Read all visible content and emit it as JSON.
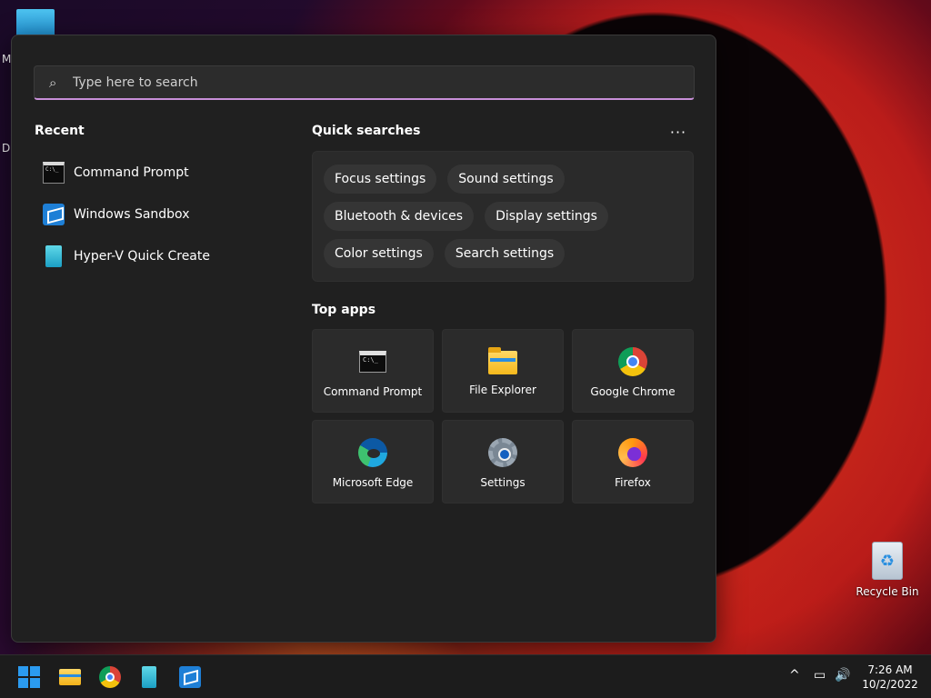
{
  "desktop": {
    "label_fragment_1": "M",
    "label_fragment_2": "Da",
    "recycle_bin": "Recycle Bin"
  },
  "search": {
    "placeholder": "Type here to search",
    "icon": "search-icon"
  },
  "recent": {
    "title": "Recent",
    "items": [
      {
        "label": "Command Prompt",
        "icon": "command-prompt-icon"
      },
      {
        "label": "Windows Sandbox",
        "icon": "windows-sandbox-icon"
      },
      {
        "label": "Hyper-V Quick Create",
        "icon": "hyper-v-icon"
      }
    ]
  },
  "quick_searches": {
    "title": "Quick searches",
    "more": "···",
    "chips": [
      "Focus settings",
      "Sound settings",
      "Bluetooth & devices",
      "Display settings",
      "Color settings",
      "Search settings"
    ]
  },
  "top_apps": {
    "title": "Top apps",
    "apps": [
      {
        "label": "Command Prompt",
        "icon": "command-prompt-icon"
      },
      {
        "label": "File Explorer",
        "icon": "file-explorer-icon"
      },
      {
        "label": "Google Chrome",
        "icon": "chrome-icon"
      },
      {
        "label": "Microsoft Edge",
        "icon": "edge-icon"
      },
      {
        "label": "Settings",
        "icon": "settings-icon"
      },
      {
        "label": "Firefox",
        "icon": "firefox-icon"
      }
    ]
  },
  "taskbar": {
    "pinned": [
      "start-icon",
      "file-explorer-icon",
      "chrome-icon",
      "hyper-v-icon",
      "windows-sandbox-icon"
    ],
    "tray": {
      "chevron": "^",
      "network": "▭",
      "volume": "🔊",
      "time": "7:26 AM",
      "date": "10/2/2022"
    }
  },
  "colors": {
    "panel_bg": "#202020",
    "search_underline": "#c88fd8",
    "accent": "#2b9bf0"
  }
}
